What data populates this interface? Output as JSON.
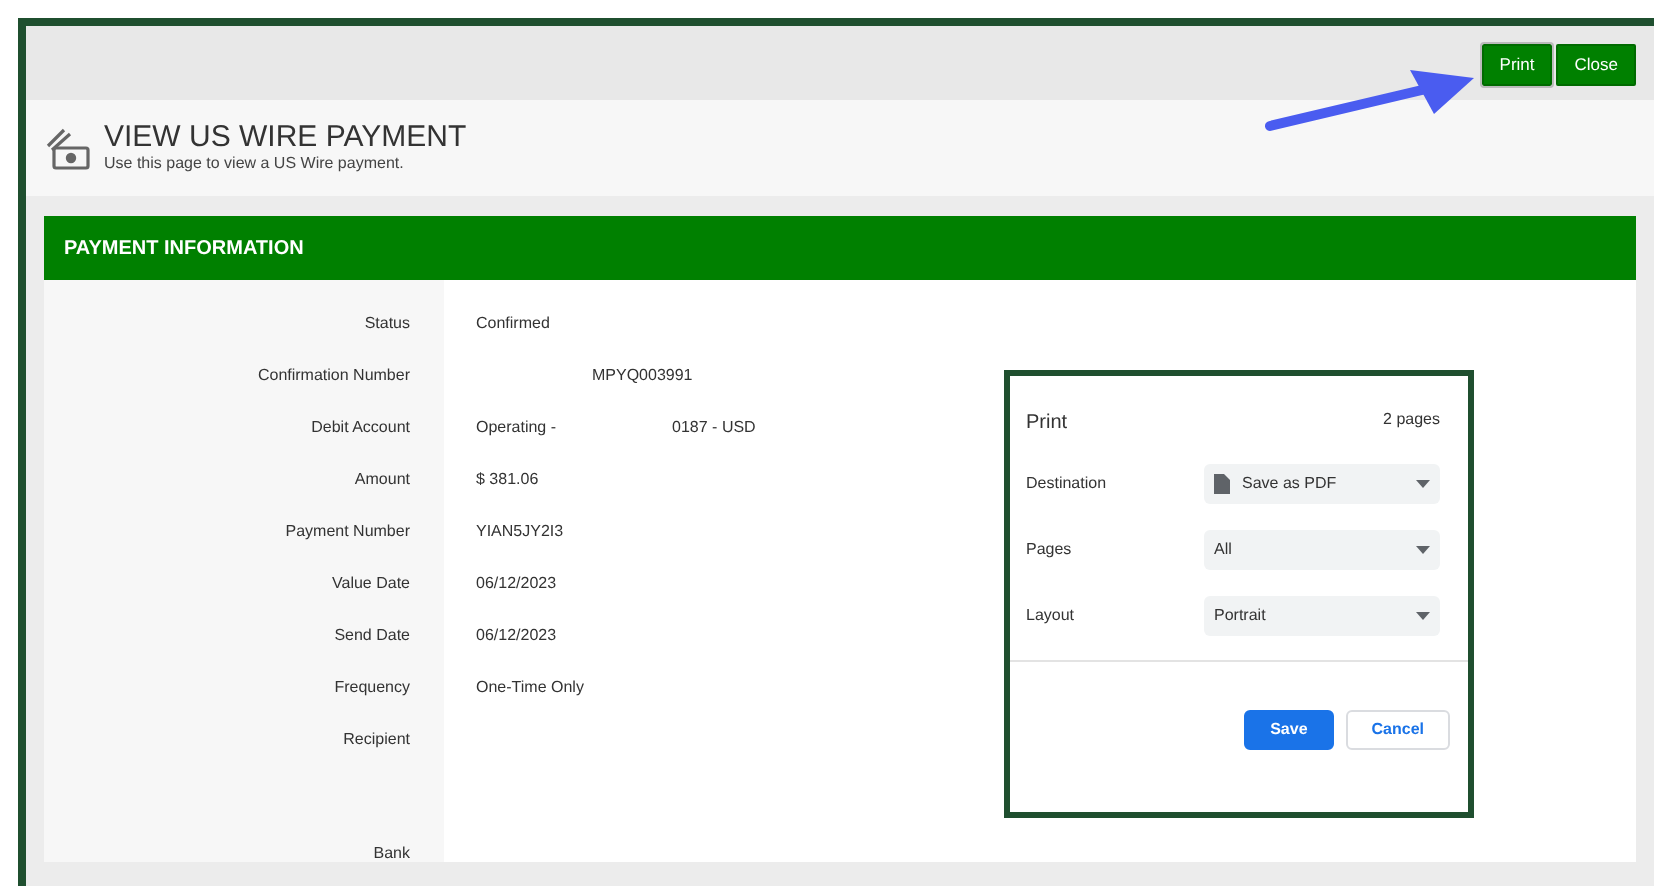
{
  "toolbar": {
    "buttons": [
      {
        "label": "Print",
        "selected": true
      },
      {
        "label": "Close",
        "selected": false
      }
    ]
  },
  "page_header": {
    "title": "VIEW US WIRE PAYMENT",
    "subtitle": "Use this page to view a US Wire payment."
  },
  "panel": {
    "title": "PAYMENT INFORMATION",
    "fields": [
      {
        "label": "Status",
        "parts": [
          "Confirmed"
        ]
      },
      {
        "label": "Confirmation Number",
        "parts": [
          "MPYQ003991"
        ],
        "redacted": true
      },
      {
        "label": "Debit Account",
        "parts": [
          "Operating -",
          "0187 - USD"
        ],
        "redacted": true
      },
      {
        "label": "Amount",
        "parts": [
          "$ 381.06"
        ]
      },
      {
        "label": "Payment Number",
        "parts": [
          "YIAN5JY2I3"
        ]
      },
      {
        "label": "Value Date",
        "parts": [
          "06/12/2023"
        ]
      },
      {
        "label": "Send Date",
        "parts": [
          "06/12/2023"
        ]
      },
      {
        "label": "Frequency",
        "parts": [
          "One-Time Only"
        ]
      },
      {
        "label": "Recipient",
        "tall": true
      },
      {
        "label": "Bank"
      }
    ]
  },
  "print_dialog": {
    "title": "Print",
    "page_count": "2 pages",
    "settings": [
      {
        "label": "Destination",
        "value": "Save as PDF",
        "kind": "file"
      },
      {
        "label": "Pages",
        "value": "All",
        "kind": "plain"
      },
      {
        "label": "Layout",
        "value": "Portrait",
        "kind": "plain"
      }
    ],
    "buttons": [
      {
        "label": "Save",
        "kind": "primary"
      },
      {
        "label": "Cancel",
        "kind": "secondary"
      }
    ]
  }
}
